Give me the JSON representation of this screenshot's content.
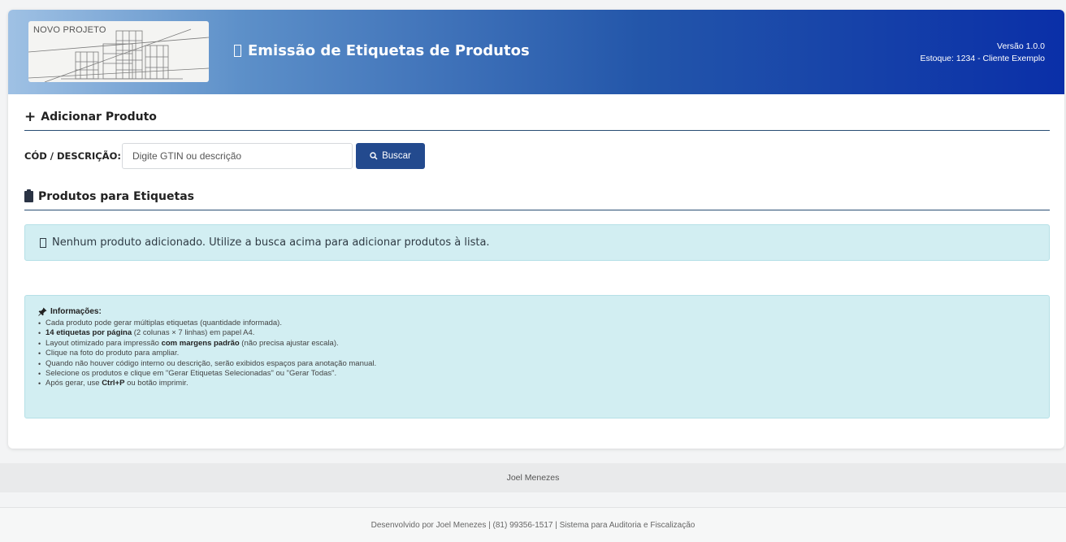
{
  "header": {
    "logo_text": "NOVO PROJETO",
    "title": "Emissão de Etiquetas de Produtos",
    "version": "Versão 1.0.0",
    "stock": "Estoque: 1234 - Cliente Exemplo"
  },
  "add_section": {
    "title": "Adicionar Produto",
    "search_label": "CÓD / DESCRIÇÃO:",
    "search_placeholder": "Digite GTIN ou descrição",
    "search_value": "",
    "search_button": "Buscar"
  },
  "products_section": {
    "title": "Produtos para Etiquetas",
    "empty_message": "Nenhum produto adicionado. Utilize a busca acima para adicionar produtos à lista."
  },
  "info": {
    "title": "Informações:",
    "items": [
      {
        "pre": "Cada produto pode gerar múltiplas etiquetas (quantidade informada).",
        "bold": "",
        "post": ""
      },
      {
        "pre": "",
        "bold": "14 etiquetas por página",
        "post": " (2 colunas × 7 linhas) em papel A4."
      },
      {
        "pre": "Layout otimizado para impressão ",
        "bold": "com margens padrão",
        "post": " (não precisa ajustar escala)."
      },
      {
        "pre": "Clique na foto do produto para ampliar.",
        "bold": "",
        "post": ""
      },
      {
        "pre": "Quando não houver código interno ou descrição, serão exibidos espaços para anotação manual.",
        "bold": "",
        "post": ""
      },
      {
        "pre": "Selecione os produtos e clique em \"Gerar Etiquetas Selecionadas\" ou \"Gerar Todas\".",
        "bold": "",
        "post": ""
      },
      {
        "pre": "Após gerar, use ",
        "bold": "Ctrl+P",
        "post": " ou botão imprimir."
      }
    ]
  },
  "credit": "Joel Menezes",
  "footer": "Desenvolvido por Joel Menezes | (81) 99356-1517 | Sistema para Auditoria e Fiscalização",
  "colors": {
    "primary": "#234a8e",
    "header_dark": "#0a2fa8",
    "alert_bg": "#d2eef2",
    "divider": "#284d73"
  },
  "icons": {
    "title": "box-icon",
    "add": "plus-icon",
    "search": "search-icon",
    "products": "clipboard-icon",
    "info": "pin-icon"
  }
}
